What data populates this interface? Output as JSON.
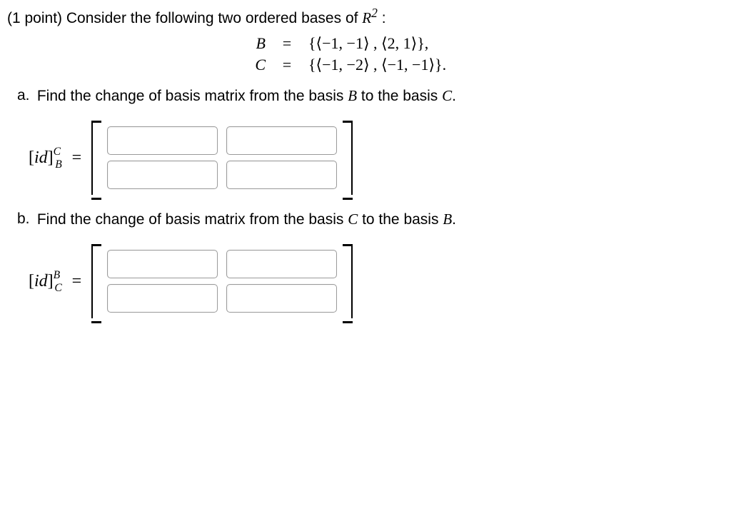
{
  "intro": {
    "points": "(1 point)",
    "text_before": "Consider the following two ordered bases of ",
    "space": "R",
    "space_sup": "2",
    "colon": ":"
  },
  "basis_definitions": {
    "B_label": "B",
    "B_eq": "=",
    "B_value": "{⟨−1, −1⟩ , ⟨2, 1⟩},",
    "C_label": "C",
    "C_eq": "=",
    "C_value": "{⟨−1, −2⟩ , ⟨−1, −1⟩}."
  },
  "part_a": {
    "label": "a.",
    "text_before": "Find the change of basis matrix from the basis ",
    "basis_from": "B",
    "text_mid": " to the basis ",
    "basis_to": "C",
    "text_after": ".",
    "lhs_open": "[",
    "lhs_id": "id",
    "lhs_close": "]",
    "lhs_sup": "C",
    "lhs_sub": "B",
    "lhs_eq": " ="
  },
  "part_b": {
    "label": "b.",
    "text_before": "Find the change of basis matrix from the basis ",
    "basis_from": "C",
    "text_mid": " to the basis ",
    "basis_to": "B",
    "text_after": ".",
    "lhs_open": "[",
    "lhs_id": "id",
    "lhs_close": "]",
    "lhs_sup": "B",
    "lhs_sub": "C",
    "lhs_eq": " ="
  },
  "matrix_a": {
    "m11": "",
    "m12": "",
    "m21": "",
    "m22": ""
  },
  "matrix_b": {
    "m11": "",
    "m12": "",
    "m21": "",
    "m22": ""
  }
}
